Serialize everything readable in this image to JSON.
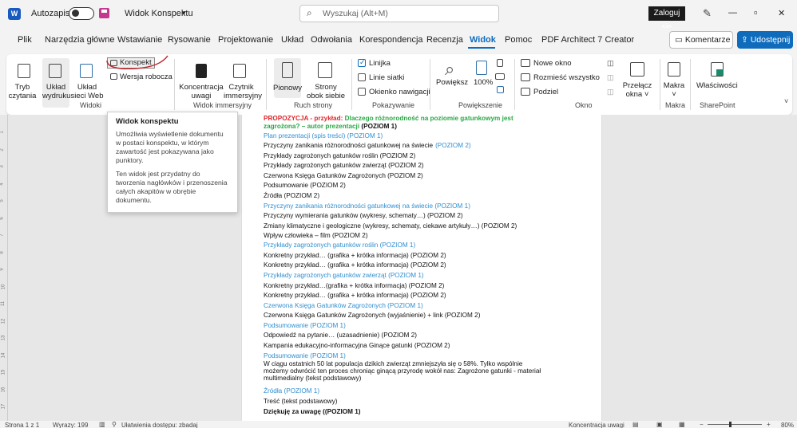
{
  "titlebar": {
    "autosave": "Autozapis",
    "filename": "Widok Konspektu",
    "filename_chevron": "▾",
    "search_placeholder": "Wyszukaj (Alt+M)",
    "signin": "Zaloguj się",
    "minimize": "—",
    "maximize": "▫",
    "close": "✕"
  },
  "tabs": [
    "Plik",
    "Narzędzia główne",
    "Wstawianie",
    "Rysowanie",
    "Projektowanie",
    "Układ",
    "Odwołania",
    "Korespondencja",
    "Recenzja",
    "Widok",
    "Pomoc",
    "PDF Architect 7 Creator"
  ],
  "comments_btn": "Komentarze",
  "share_btn": "Udostępnij",
  "ribbon": {
    "tryb_czytania": "Tryb\nczytania",
    "uklad_wydruku": "Układ\nwydruku",
    "uklad_sieci": "Układ\nsieci Web",
    "konspekt": "Konspekt",
    "wersja_robocza": "Wersja robocza",
    "widoki": "Widoki",
    "koncentracja": "Koncentracja\nuwagi",
    "czytnik": "Czytnik\nimmersyjny",
    "widok_immersyjny": "Widok immersyjny",
    "pionowy": "Pionowy",
    "strony_obok": "Strony\nobok siebie",
    "ruch_strony": "Ruch strony",
    "linijka": "Linijka",
    "linie_siatki": "Linie siatki",
    "okienko": "Okienko nawigacji",
    "pokazywanie": "Pokazywanie",
    "powieksz": "Powiększ",
    "zoom100": "100%",
    "powiekszenie": "Powiększenie",
    "nowe_okno": "Nowe okno",
    "rozmiesc": "Rozmieść wszystko",
    "podziel": "Podziel",
    "okno": "Okno",
    "przelacz": "Przełącz\nokna ˅",
    "makra": "Makra\n˅",
    "makra_grp": "Makra",
    "wlasciwosci": "Właściwości",
    "sharepoint": "SharePoint"
  },
  "tooltip": {
    "title": "Widok konspektu",
    "body1": "Umożliwia wyświetlenie dokumentu w postaci konspektu, w którym zawartość jest pokazywana jako punktory.",
    "body2": "Ten widok jest przydatny do tworzenia nagłówków i przenoszenia całych akapitów w obrębie dokumentu."
  },
  "doc": {
    "l0a_red": "PROPOZYCJA - przykład:",
    "l0a_green": "Dlaczego różnorodność na poziomie gatunkowym jest",
    "l0b_green": "zagrożona? – autor prezentacji",
    "l0b_black": "(POZIOM 1)",
    "lines": [
      {
        "t": "Plan prezentacji (spis treści) (POZIOM 1)",
        "h": true
      },
      {
        "t": "Przyczyny zanikania różnorodności gatunkowej na świecie",
        "s": "(POZIOM 2)"
      },
      {
        "t": "Przykłady zagrożonych gatunków roślin (POZIOM 2)"
      },
      {
        "t": "Przykłady zagrożonych gatunków zwierząt (POZIOM 2)"
      },
      {
        "t": "Czerwona Księga Gatunków Zagrożonych (POZIOM 2)"
      },
      {
        "t": "Podsumowanie (POZIOM 2)"
      },
      {
        "t": "Źródła (POZIOM 2)"
      },
      {
        "t": "Przyczyny zanikania różnorodności gatunkowej na świecie (POZIOM 1)",
        "h": true
      },
      {
        "t": "Przyczyny wymierania gatunków (wykresy, schematy…) (POZIOM 2)"
      },
      {
        "t": "Zmiany klimatyczne i geologiczne (wykresy, schematy, ciekawe artykuły…) (POZIOM 2)"
      },
      {
        "t": "Wpływ człowieka – film (POZIOM 2)"
      },
      {
        "t": "Przykłady zagrożonych gatunków roślin (POZIOM 1)",
        "h": true
      },
      {
        "t": "Konkretny przykład… (grafika + krótka informacja) (POZIOM 2)"
      },
      {
        "t": "Konkretny przykład… (grafika + krótka informacja) (POZIOM 2)"
      },
      {
        "t": "Przykłady zagrożonych gatunków zwierząt (POZIOM 1)",
        "h": true
      },
      {
        "t": "Konkretny przykład…(grafika + krótka informacja) (POZIOM 2)"
      },
      {
        "t": "Konkretny przykład… (grafika + krótka informacja) (POZIOM 2)"
      },
      {
        "t": "Czerwona Księga Gatunków Zagrożonych (POZIOM 1)",
        "h": true
      },
      {
        "t": "Czerwona Księga Gatunków Zagrożonych (wyjaśnienie) + link (POZIOM 2)"
      },
      {
        "t": "Podsumowanie (POZIOM 1)",
        "h": true
      },
      {
        "t": "Odpowiedź na pytanie… (uzasadnienie) (POZIOM 2)"
      },
      {
        "t": "Kampania edukacyjno-informacyjna Ginące gatunki (POZIOM 2)"
      },
      {
        "t": "Podsumowanie (POZIOM 1)",
        "h": true
      },
      {
        "t": "W ciągu ostatnich 50 lat populacja dzikich zwierząt zmniejszyła się o 58%. Tylko wspólnie"
      },
      {
        "t": "możemy odwrócić ten proces chroniąc ginącą przyrodę wokół nas: Zagrożone gatunki - materiał"
      },
      {
        "t": "multimedialny (tekst podstawowy)"
      },
      {
        "t": "Źródła (POZIOM 1)",
        "h": true
      },
      {
        "t": "Treść (tekst podstawowy)"
      },
      {
        "t": "Dziękuję za uwagę ((POZIOM 1)"
      }
    ]
  },
  "ruler_ticks": [
    "1",
    "2",
    "3",
    "4",
    "5",
    "6",
    "7",
    "8",
    "9",
    "10",
    "11",
    "12",
    "13",
    "14",
    "15",
    "16",
    "17"
  ],
  "status": {
    "page": "Strona 1 z 1",
    "words": "Wyrazy: 199",
    "accessibility": "Ułatwienia dostępu: zbadaj",
    "focus": "Koncentracja uwagi",
    "zoom": "80%",
    "minus": "−",
    "plus": "+"
  },
  "colors": {
    "accent": "#0f6cbd",
    "heading": "#2f8fd1",
    "red": "#e0262b",
    "green": "#2aa845",
    "annot": "#c0272d"
  }
}
